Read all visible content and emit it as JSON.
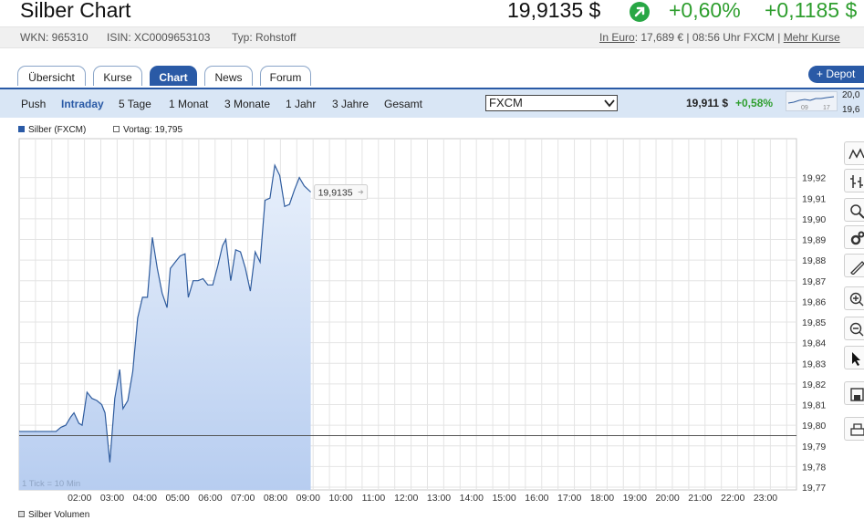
{
  "header": {
    "title": "Silber Chart",
    "price": "19,9135 $",
    "change_pct": "+0,60%",
    "change_abs": "+0,1185 $"
  },
  "info": {
    "wkn": "WKN: 965310",
    "isin": "ISIN: XC0009653103",
    "typ": "Typ: Rohstoff",
    "euro_link": "In Euro",
    "euro_value": ": 17,689 € | 08:56 Uhr FXCM | ",
    "more_link": "Mehr Kurse"
  },
  "tabs": [
    "Übersicht",
    "Kurse",
    "Chart",
    "News",
    "Forum"
  ],
  "active_tab": "Chart",
  "depot_button": "+ Depot",
  "ranges": [
    "Push",
    "Intraday",
    "5 Tage",
    "1 Monat",
    "3 Monate",
    "1 Jahr",
    "3 Jahre",
    "Gesamt"
  ],
  "active_range": "Intraday",
  "exchange_select": "FXCM",
  "mini": {
    "price": "19,911 $",
    "change": "+0,58%",
    "val_high": "20,0",
    "val_low": "19,6",
    "x_labels": [
      "09",
      "17"
    ]
  },
  "legend": {
    "series": "Silber (FXCM)",
    "prev": "Vortag: 19,795",
    "volume": "Silber Volumen"
  },
  "colors": {
    "brand_blue": "#2a5aa6",
    "positive": "#2e9e2e",
    "line": "#2f5c9e",
    "fill_top": "#e8f0fb",
    "fill_bottom": "#b7cdf0"
  },
  "chart_data": {
    "type": "area",
    "tick_note": "1 Tick = 10 Min",
    "last_value_label": "19,9135",
    "previous_close": 19.795,
    "ylim": [
      19.77,
      19.93
    ],
    "yticks": [
      "19,92",
      "19,91",
      "19,90",
      "19,89",
      "19,88",
      "19,87",
      "19,86",
      "19,85",
      "19,84",
      "19,83",
      "19,82",
      "19,81",
      "19,80",
      "19,79",
      "19,78",
      "19,77"
    ],
    "x_tick_labels": [
      "02:00",
      "03:00",
      "04:00",
      "05:00",
      "06:00",
      "07:00",
      "08:00",
      "09:00",
      "10:00",
      "11:00",
      "12:00",
      "13:00",
      "14:00",
      "15:00",
      "16:00",
      "17:00",
      "18:00",
      "19:00",
      "20:00",
      "21:00",
      "22:00",
      "23:00"
    ],
    "x_hours": [
      1.1,
      1.25,
      1.4,
      1.55,
      1.65,
      1.8,
      1.9,
      2.05,
      2.2,
      2.35,
      2.5,
      2.6,
      2.75,
      2.9,
      3.05,
      3.15,
      3.3,
      3.45,
      3.6,
      3.75,
      3.9,
      4.05,
      4.2,
      4.35,
      4.5,
      4.6,
      4.75,
      4.9,
      5.05,
      5.15,
      5.3,
      5.45,
      5.6,
      5.75,
      5.9,
      6.05,
      6.2,
      6.3,
      6.45,
      6.6,
      6.75,
      6.9,
      7.05,
      7.2,
      7.35,
      7.5,
      7.65,
      7.8,
      7.95,
      8.1,
      8.25,
      8.4,
      8.55,
      8.7,
      8.9
    ],
    "values": [
      19.797,
      19.799,
      19.8,
      19.804,
      19.806,
      19.801,
      19.8,
      19.816,
      19.813,
      19.812,
      19.81,
      19.806,
      19.782,
      19.813,
      19.827,
      19.808,
      19.812,
      19.826,
      19.852,
      19.862,
      19.862,
      19.891,
      19.876,
      19.864,
      19.857,
      19.876,
      19.879,
      19.882,
      19.883,
      19.862,
      19.87,
      19.87,
      19.871,
      19.868,
      19.868,
      19.877,
      19.887,
      19.89,
      19.87,
      19.885,
      19.884,
      19.876,
      19.865,
      19.884,
      19.879,
      19.909,
      19.91,
      19.926,
      19.921,
      19.906,
      19.907,
      19.914,
      19.92,
      19.916,
      19.913
    ]
  }
}
